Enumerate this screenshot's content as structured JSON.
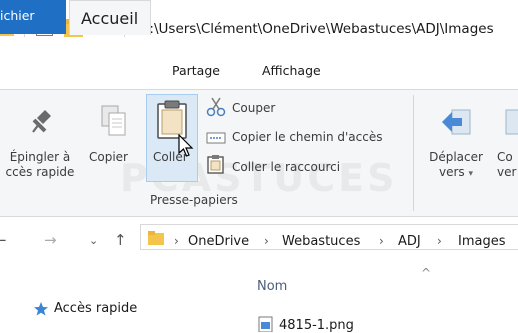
{
  "titlebar": {
    "path": "C:\\Users\\Clément\\OneDrive\\Webastuces\\ADJ\\Images"
  },
  "tabs": [
    {
      "label": "ichier"
    },
    {
      "label": "Accueil"
    },
    {
      "label": "Partage"
    },
    {
      "label": "Affichage"
    }
  ],
  "ribbon": {
    "pin_label_1": "Épingler à",
    "pin_label_2": "ccès rapide",
    "copy_label": "Copier",
    "paste_label": "Coller",
    "cut_label": "Couper",
    "copy_path_label": "Copier le chemin d'accès",
    "paste_shortcut_label": "Coller le raccourci",
    "group_label": "Presse-papiers",
    "move_label_1": "Déplacer",
    "move_label_2": "vers",
    "copy_to_label_1": "Co",
    "copy_to_label_2": "ver",
    "watermark": "PCASTUCES"
  },
  "address": {
    "crumbs": [
      "OneDrive",
      "Webastuces",
      "ADJ",
      "Images"
    ]
  },
  "content": {
    "column_name": "Nom",
    "nav_quick_access": "Accès rapide",
    "file_name": "4815-1.png"
  }
}
